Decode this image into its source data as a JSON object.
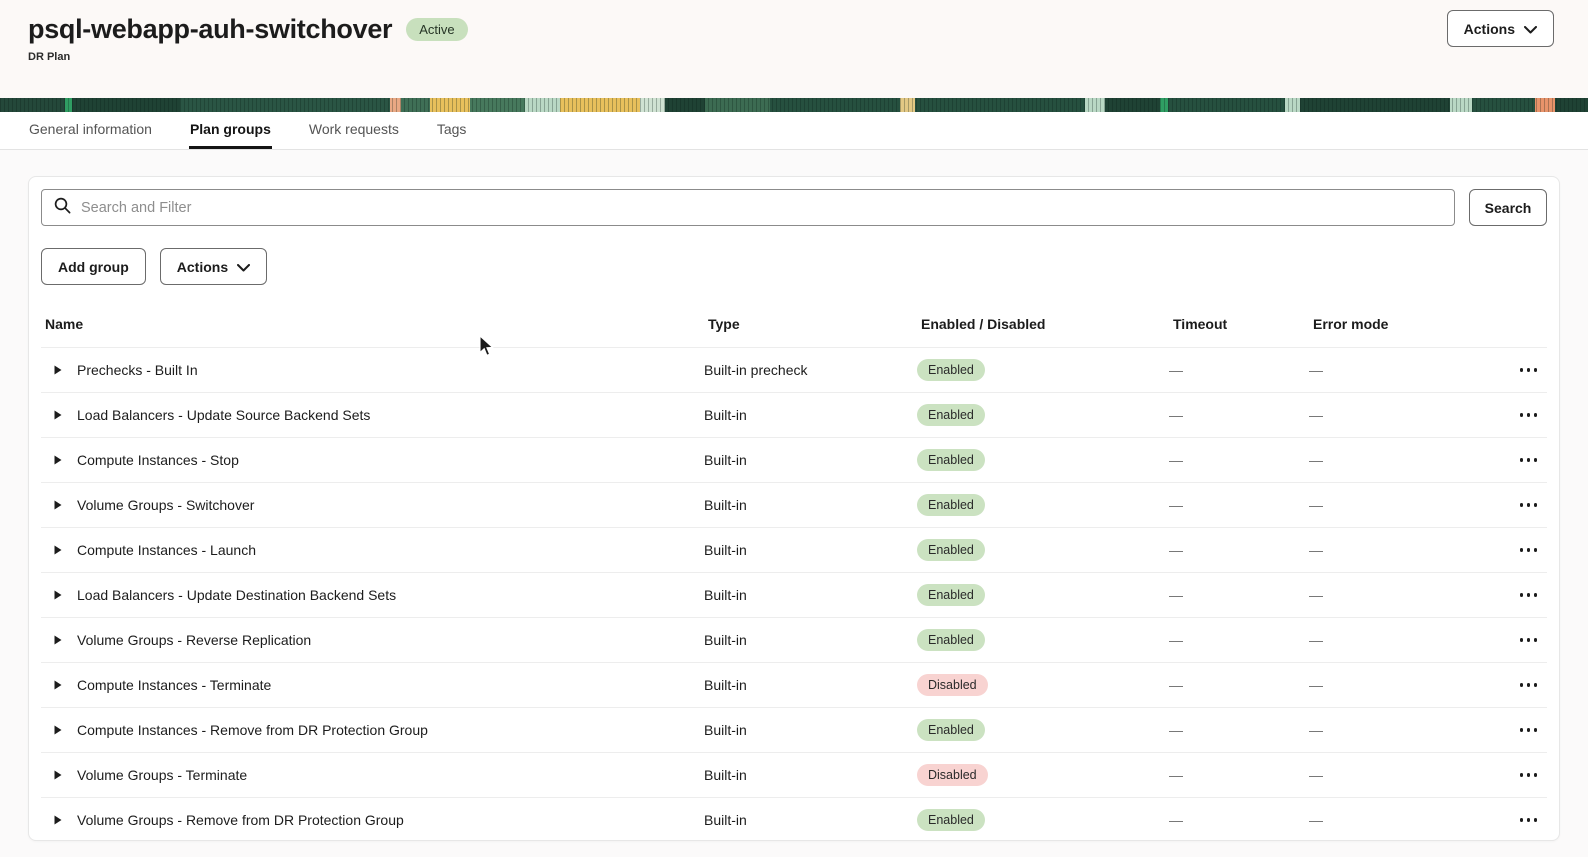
{
  "page": {
    "title": "psql-webapp-auh-switchover",
    "status_badge": "Active",
    "resource_type": "DR Plan",
    "actions_label": "Actions"
  },
  "tabs": [
    {
      "label": "General information",
      "active": false
    },
    {
      "label": "Plan groups",
      "active": true
    },
    {
      "label": "Work requests",
      "active": false
    },
    {
      "label": "Tags",
      "active": false
    }
  ],
  "toolbar": {
    "search_placeholder": "Search and Filter",
    "search_value": "",
    "search_button": "Search",
    "add_group_button": "Add group",
    "actions_button": "Actions"
  },
  "table": {
    "columns": [
      "Name",
      "Type",
      "Enabled / Disabled",
      "Timeout",
      "Error mode"
    ],
    "empty_value": "—",
    "rows": [
      {
        "name": "Prechecks - Built In",
        "type": "Built-in precheck",
        "status": "Enabled",
        "timeout": "—",
        "error_mode": "—"
      },
      {
        "name": "Load Balancers - Update Source Backend Sets",
        "type": "Built-in",
        "status": "Enabled",
        "timeout": "—",
        "error_mode": "—"
      },
      {
        "name": "Compute Instances - Stop",
        "type": "Built-in",
        "status": "Enabled",
        "timeout": "—",
        "error_mode": "—"
      },
      {
        "name": "Volume Groups - Switchover",
        "type": "Built-in",
        "status": "Enabled",
        "timeout": "—",
        "error_mode": "—"
      },
      {
        "name": "Compute Instances - Launch",
        "type": "Built-in",
        "status": "Enabled",
        "timeout": "—",
        "error_mode": "—"
      },
      {
        "name": "Load Balancers - Update Destination Backend Sets",
        "type": "Built-in",
        "status": "Enabled",
        "timeout": "—",
        "error_mode": "—"
      },
      {
        "name": "Volume Groups - Reverse Replication",
        "type": "Built-in",
        "status": "Enabled",
        "timeout": "—",
        "error_mode": "—"
      },
      {
        "name": "Compute Instances - Terminate",
        "type": "Built-in",
        "status": "Disabled",
        "timeout": "—",
        "error_mode": "—"
      },
      {
        "name": "Compute Instances - Remove from DR Protection Group",
        "type": "Built-in",
        "status": "Enabled",
        "timeout": "—",
        "error_mode": "—"
      },
      {
        "name": "Volume Groups - Terminate",
        "type": "Built-in",
        "status": "Disabled",
        "timeout": "—",
        "error_mode": "—"
      },
      {
        "name": "Volume Groups - Remove from DR Protection Group",
        "type": "Built-in",
        "status": "Enabled",
        "timeout": "—",
        "error_mode": "—"
      }
    ]
  },
  "colors": {
    "active_badge_bg": "#c8e0bd",
    "enabled_badge_bg": "#cbe2c1",
    "disabled_badge_bg": "#f8d3d1",
    "banner_dark_green": "#1f4234",
    "banner_bright_green": "#2f9e63",
    "banner_mint": "#b9d8c4",
    "banner_gold": "#e8c05c",
    "banner_orange": "#e8936a",
    "header_bg": "#fcf9f7"
  },
  "icons": {
    "search": "magnifier-glyph",
    "chevron_down": "∨",
    "row_expand": "▶",
    "row_actions": "⋯"
  }
}
